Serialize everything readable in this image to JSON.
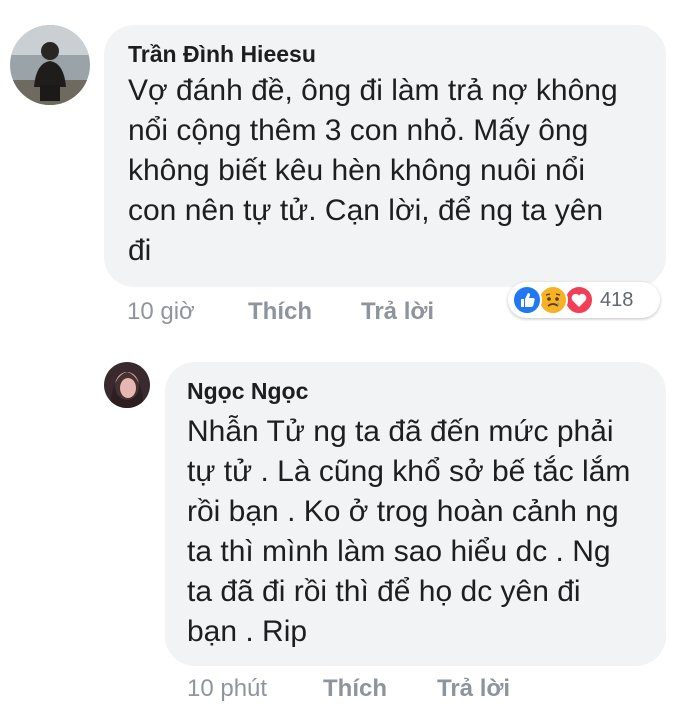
{
  "comments": [
    {
      "author": "Trần Đình Hieesu",
      "lines": [
        "Vợ đánh đề, ông đi làm trả nợ không",
        "nổi cộng thêm 3 con nhỏ. Mấy ông",
        "không biết kêu hèn không nuôi nổi",
        "con nên tự tử. Cạn lời, để ng ta yên",
        "đi"
      ],
      "time": "10 giờ",
      "like_label": "Thích",
      "reply_label": "Trả lời",
      "reactions": {
        "icons": [
          "like-icon",
          "sad-icon",
          "love-icon"
        ],
        "count": "418"
      }
    },
    {
      "author": "Ngọc Ngọc",
      "lines": [
        "Nhẫn Tử ng ta đã đến mức phải",
        "tự tử . Là cũng khổ sở bế tắc lắm",
        "rồi bạn . Ko ở trog hoàn cảnh ng",
        "ta thì mình làm sao hiểu dc . Ng",
        "ta đã đi rồi thì để họ dc yên đi",
        "bạn . Rip"
      ],
      "time": "10 phút",
      "like_label": "Thích",
      "reply_label": "Trả lời"
    }
  ],
  "colors": {
    "bubble": "#f2f3f5",
    "meta_text": "#90949c",
    "like_blue": "#2078f4",
    "love_red": "#f33e58",
    "sad_yellow": "#f7b125"
  }
}
